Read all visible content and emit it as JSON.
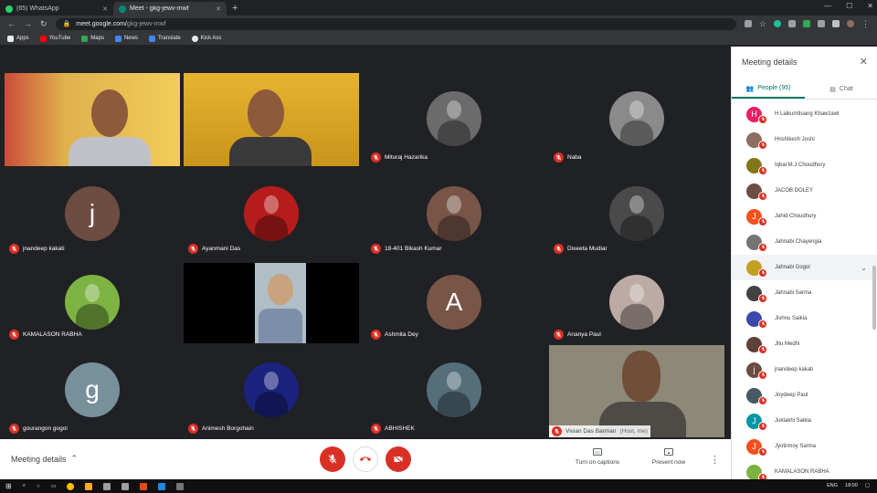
{
  "browser": {
    "tabs": [
      {
        "title": "(65) WhatsApp",
        "icon": "whatsapp-icon",
        "color": "#25d366",
        "active": false
      },
      {
        "title": "Meet - gkg-jewv-mwf",
        "icon": "meet-icon",
        "color": "#00897b",
        "active": true
      }
    ],
    "new_tab": "+",
    "url_host": "meet.google.com/",
    "url_path": "gkg-jewv-mwf",
    "bookmarks": [
      {
        "label": "Apps",
        "color": "#e8eaed"
      },
      {
        "label": "YouTube",
        "color": "#ff0000"
      },
      {
        "label": "Maps",
        "color": "#34a853"
      },
      {
        "label": "News",
        "color": "#4285f4"
      },
      {
        "label": "Translate",
        "color": "#4285f4"
      },
      {
        "label": "Kick Ass",
        "color": "#e8eaed"
      }
    ]
  },
  "participants_grid": [
    {
      "name": "",
      "type": "video",
      "bg": "#d8a63a"
    },
    {
      "name": "",
      "type": "video",
      "bg": "#d9a81e"
    },
    {
      "name": "Mituraj Hazarika",
      "type": "photo",
      "bg": "#6b6b6b"
    },
    {
      "name": "Naba",
      "type": "photo",
      "bg": "#8a8a8a"
    },
    {
      "name": "jnandeep kakati",
      "type": "letter",
      "letter": "j",
      "bg": "#6d4c41"
    },
    {
      "name": "Ayanmani Das",
      "type": "photo",
      "bg": "#b71c1c"
    },
    {
      "name": "18-401 Bikash Kumar",
      "type": "photo",
      "bg": "#795548"
    },
    {
      "name": "Dixeeta Mudiar",
      "type": "photo",
      "bg": "#4a4a4a"
    },
    {
      "name": "KAMALASON RABHA",
      "type": "photo",
      "bg": "#7cb342"
    },
    {
      "name": "",
      "type": "video",
      "bg": "#b0bec5"
    },
    {
      "name": "Ashmita Dey",
      "type": "letter",
      "letter": "A",
      "bg": "#795548"
    },
    {
      "name": "Ananya Paul",
      "type": "photo",
      "bg": "#bcaaa4"
    },
    {
      "name": "gourangon gogoi",
      "type": "letter",
      "letter": "g",
      "bg": "#78909c"
    },
    {
      "name": "Animesh Borgohain",
      "type": "photo",
      "bg": "#1a237e"
    },
    {
      "name": "ABHISHEK",
      "type": "photo",
      "bg": "#546e7a"
    },
    {
      "name": "Vivian Das Barman",
      "type": "self",
      "suffix": "(Host, me)",
      "bg": "#8d8878"
    }
  ],
  "bottom": {
    "meeting_details": "Meeting details",
    "captions_label": "Turn on captions",
    "present_label": "Present now"
  },
  "panel": {
    "title": "Meeting details",
    "people_tab": "People (95)",
    "chat_tab": "Chat",
    "people": [
      {
        "name": "H Lalkumtluang Khawzawl",
        "letter": "H",
        "color": "#e91e63"
      },
      {
        "name": "Hrishikesh Joshi",
        "letter": "",
        "color": "#8d6e63"
      },
      {
        "name": "Iqbal M.J Choudhury",
        "letter": "",
        "color": "#827717"
      },
      {
        "name": "JACOB DOLEY",
        "letter": "",
        "color": "#6d4c41"
      },
      {
        "name": "Jahid Choudhury",
        "letter": "J",
        "color": "#f4511e"
      },
      {
        "name": "Jahnabi Chayengia",
        "letter": "",
        "color": "#757575"
      },
      {
        "name": "Jahnabi Gogoi",
        "letter": "",
        "color": "#c0a020"
      },
      {
        "name": "Jahnabi Sarma",
        "letter": "",
        "color": "#424242"
      },
      {
        "name": "Jishnu Saikia",
        "letter": "",
        "color": "#3949ab"
      },
      {
        "name": "Jitu Medhi",
        "letter": "",
        "color": "#5d4037"
      },
      {
        "name": "jnandeep kakati",
        "letter": "j",
        "color": "#6d4c41"
      },
      {
        "name": "Joydeep Paul",
        "letter": "",
        "color": "#455a64"
      },
      {
        "name": "Juktakhi Saikia",
        "letter": "J",
        "color": "#0097a7"
      },
      {
        "name": "Jyotirmoy Sarma",
        "letter": "J",
        "color": "#f4511e"
      },
      {
        "name": "KAMALASON RABHA",
        "letter": "",
        "color": "#7cb342"
      }
    ]
  },
  "taskbar": {
    "lang": "ENG",
    "time": "18:00"
  }
}
